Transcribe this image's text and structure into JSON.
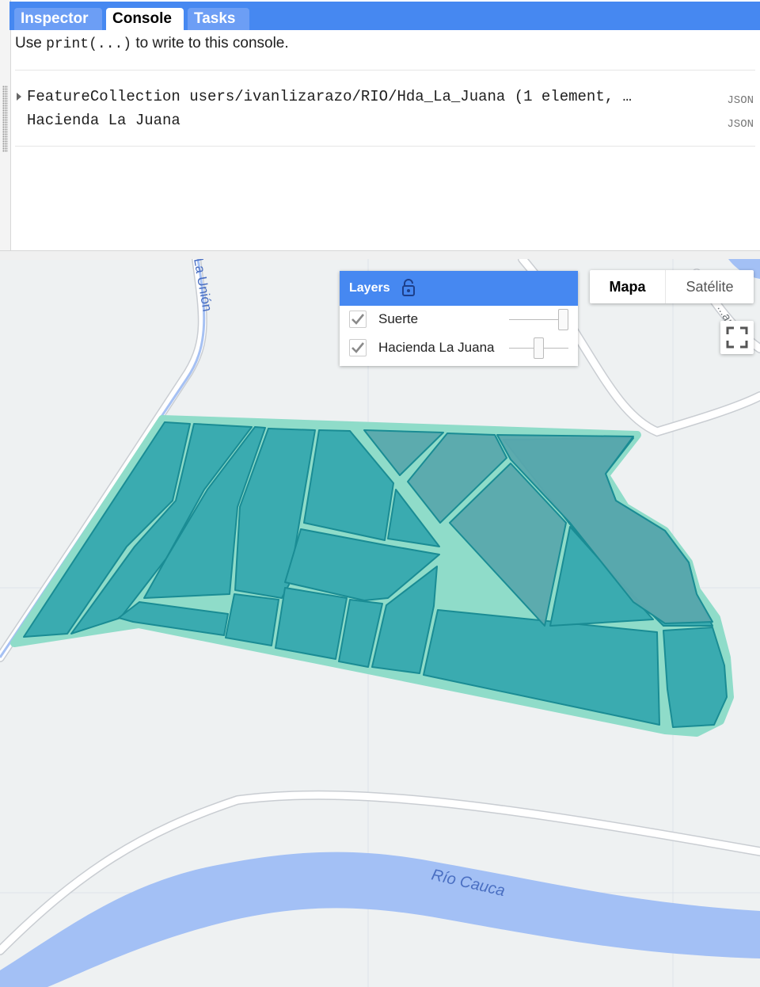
{
  "tabs": [
    {
      "label": "Inspector"
    },
    {
      "label": "Console"
    },
    {
      "label": "Tasks"
    }
  ],
  "console": {
    "hint_prefix": "Use ",
    "hint_code": "print(...)",
    "hint_suffix": " to write to this console.",
    "outputs": [
      {
        "text": "FeatureCollection users/ivanlizarazo/RIO/Hda_La_Juana (1 element, …",
        "tag": "JSON"
      },
      {
        "text": "Hacienda La Juana",
        "tag": "JSON"
      }
    ]
  },
  "layers_panel": {
    "title": "Layers",
    "layers": [
      {
        "name": "Suerte",
        "checked": true,
        "opacity": 1.0
      },
      {
        "name": "Hacienda La Juana",
        "checked": true,
        "opacity": 0.5
      }
    ]
  },
  "map_type": {
    "map": "Mapa",
    "satellite": "Satélite",
    "selected": "Mapa"
  },
  "map_labels": {
    "road_north": "La Unión",
    "road_east": "...ando",
    "river": "Río Cauca"
  },
  "colors": {
    "tab_bar": "#4688f1",
    "polygon_fill": "#3aabb0",
    "polygon_stroke": "#1a8c94",
    "outline": "#8fdcc9",
    "river": "#a3c0f5",
    "map_bg": "#eef1f2"
  }
}
